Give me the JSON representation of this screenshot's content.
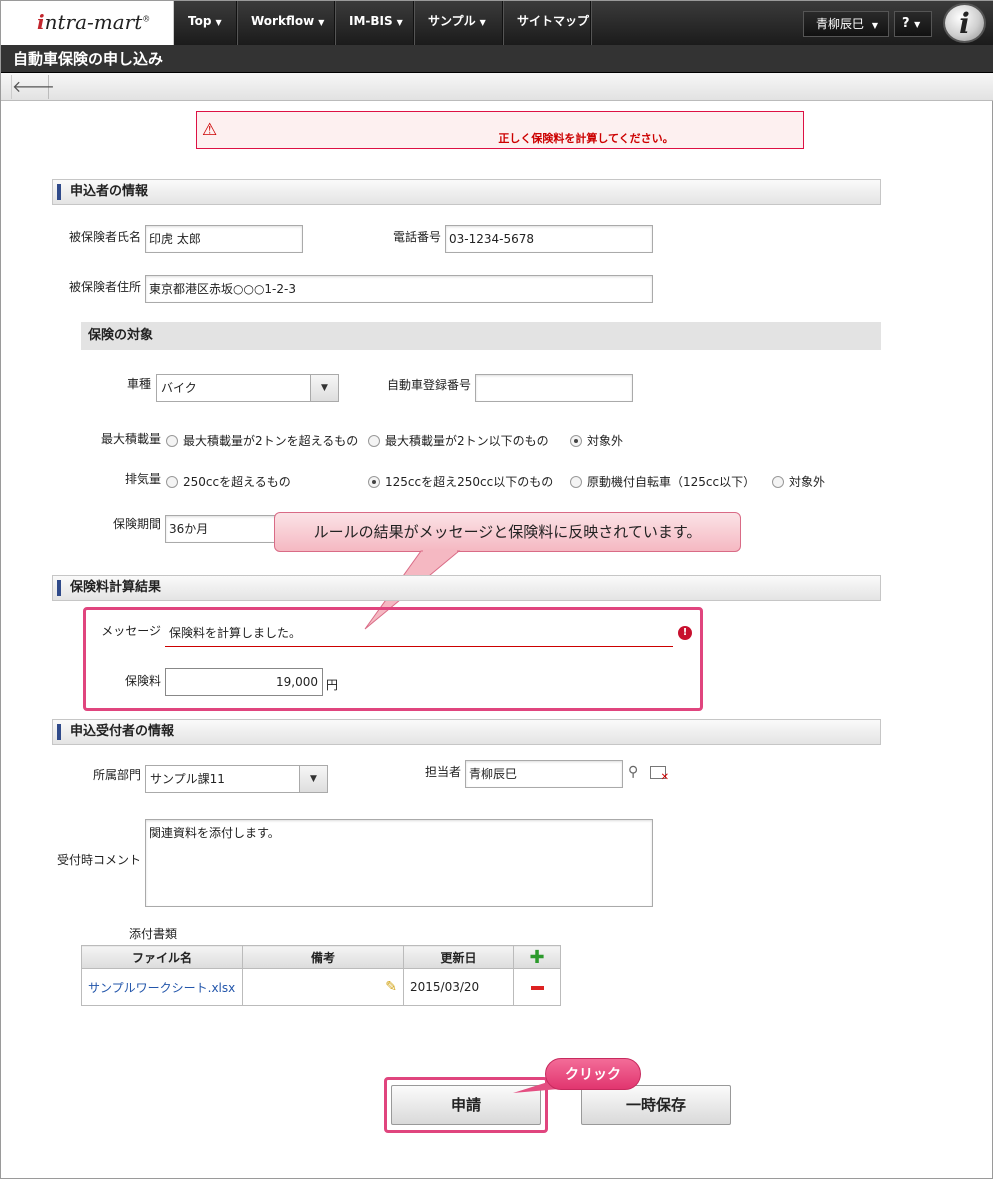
{
  "header": {
    "logo": "intra-mart",
    "nav": [
      {
        "label": "Top"
      },
      {
        "label": "Workflow"
      },
      {
        "label": "IM-BIS"
      },
      {
        "label": "サンプル"
      },
      {
        "label": "サイトマップ"
      }
    ],
    "user": "青柳辰巳",
    "help": "?",
    "badge": "i"
  },
  "page_title": "自動車保険の申し込み",
  "toolbar": {
    "back_icon": "arrow-left"
  },
  "error_banner": {
    "message": "正しく保険料を計算してください。"
  },
  "applicant": {
    "title": "申込者の情報",
    "name_label": "被保険者氏名",
    "name_value": "印虎 太郎",
    "phone_label": "電話番号",
    "phone_value": "03-1234-5678",
    "address_label": "被保険者住所",
    "address_value": "東京都港区赤坂○○○1-2-3"
  },
  "target": {
    "title": "保険の対象",
    "vehicle_type_label": "車種",
    "vehicle_type_value": "バイク",
    "reg_no_label": "自動車登録番号",
    "reg_no_value": "",
    "max_load_label": "最大積載量",
    "max_load_options": [
      "最大積載量が2トンを超えるもの",
      "最大積載量が2トン以下のもの",
      "対象外"
    ],
    "max_load_selected": 2,
    "displacement_label": "排気量",
    "displacement_options": [
      "250ccを超えるもの",
      "125ccを超え250cc以下のもの",
      "原動機付自転車（125cc以下）",
      "対象外"
    ],
    "displacement_selected": 1,
    "period_label": "保険期間",
    "period_value": "36か月"
  },
  "callout": "ルールの結果がメッセージと保険料に反映されています。",
  "result": {
    "title": "保険料計算結果",
    "message_label": "メッセージ",
    "message_value": "保険料を計算しました。",
    "fee_label": "保険料",
    "fee_value": "19,000",
    "fee_unit": "円"
  },
  "receiver": {
    "title": "申込受付者の情報",
    "dept_label": "所属部門",
    "dept_value": "サンプル課11",
    "person_label": "担当者",
    "person_value": "青柳辰巳",
    "comment_label": "受付時コメント",
    "comment_value": "関連資料を添付します。",
    "attach_label": "添付書類",
    "table_headers": [
      "ファイル名",
      "備考",
      "更新日"
    ],
    "rows": [
      {
        "file": "サンプルワークシート.xlsx",
        "note": "",
        "date": "2015/03/20"
      }
    ]
  },
  "buttons": {
    "apply": "申請",
    "save": "一時保存",
    "click_hint": "クリック"
  },
  "colors": {
    "accent_pink": "#e0457e",
    "error_red": "#c00",
    "header_dark": "#333"
  }
}
